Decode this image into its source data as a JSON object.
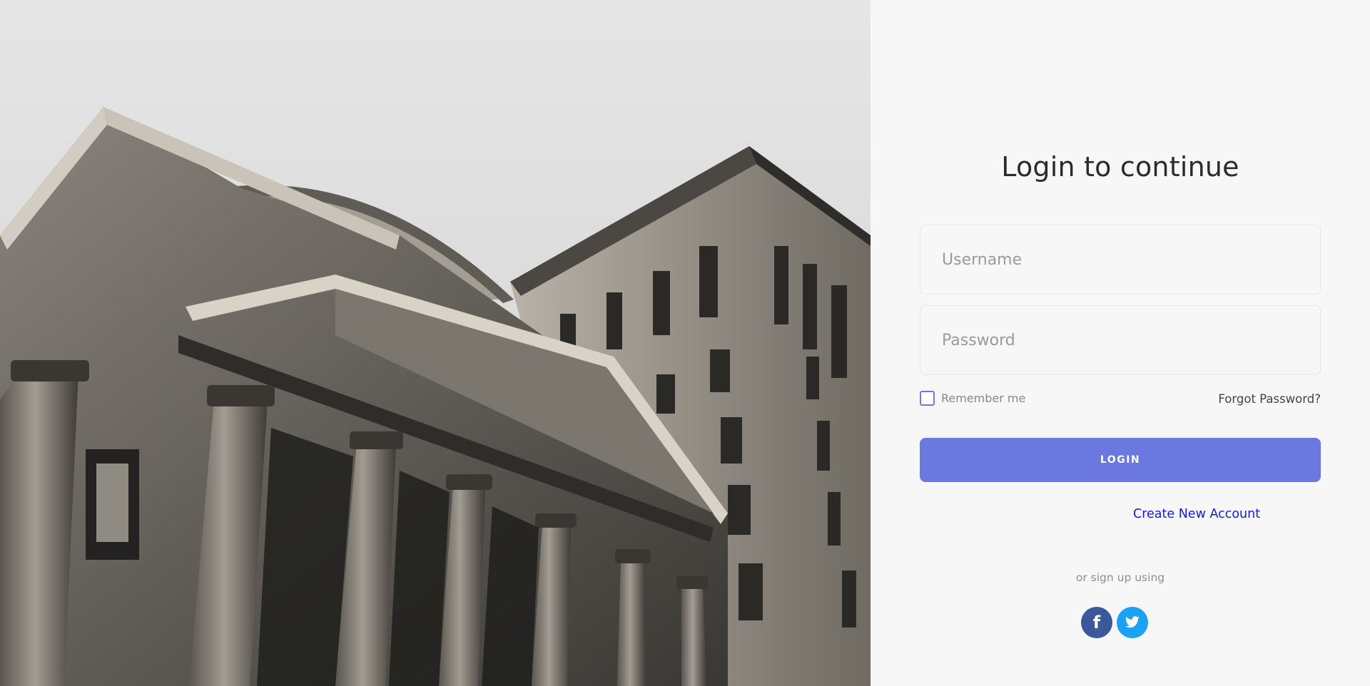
{
  "hero": {
    "image": "neoclassical-building-photo"
  },
  "login": {
    "title": "Login to continue",
    "username_placeholder": "Username",
    "username_value": "",
    "password_placeholder": "Password",
    "password_value": "",
    "remember_label": "Remember me",
    "remember_checked": false,
    "forgot_label": "Forgot Password?",
    "login_label": "LOGIN",
    "create_label": "Create New Account",
    "or_text": "or sign up using",
    "social": [
      {
        "name": "facebook",
        "icon": "facebook-icon",
        "color": "#3b5998"
      },
      {
        "name": "twitter",
        "icon": "twitter-icon",
        "color": "#1da1f2"
      }
    ]
  },
  "colors": {
    "accent": "#6b78e0",
    "link": "#1a1acc",
    "panel_bg": "#f7f7f7"
  }
}
